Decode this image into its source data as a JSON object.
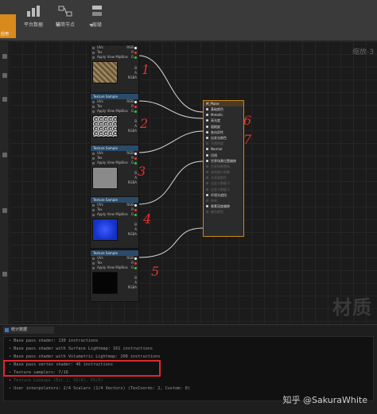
{
  "toolbar": {
    "buttons": [
      {
        "label": "应用"
      },
      {
        "label": "平台数据"
      },
      {
        "label": "精简节点"
      },
      {
        "label": "层级"
      }
    ]
  },
  "graph": {
    "zoom_label": "缩放-3",
    "watermark": "材质"
  },
  "texture_nodes": [
    {
      "header": "",
      "pins": [
        "UVs",
        "Tex",
        "Apply View MipBias"
      ],
      "outputs": [
        "RGB",
        "R",
        "G",
        "B",
        "A",
        "RGBA"
      ],
      "swatch": "metal-mesh-gold"
    },
    {
      "header": "Texture Sample",
      "pins": [
        "UVs",
        "Tex",
        "Apply View MipBias"
      ],
      "outputs": [
        "RGB",
        "R",
        "G",
        "B",
        "A",
        "RGBA"
      ],
      "swatch": "metal-mesh-silver"
    },
    {
      "header": "Texture Sample",
      "pins": [
        "UVs",
        "Tex",
        "Apply View MipBias"
      ],
      "outputs": [
        "RGB",
        "R",
        "G",
        "B",
        "A",
        "RGBA"
      ],
      "swatch": "flat-grey"
    },
    {
      "header": "Texture Sample",
      "pins": [
        "UVs",
        "Tex",
        "Apply View MipBias"
      ],
      "outputs": [
        "RGB",
        "R",
        "G",
        "B",
        "A",
        "RGBA"
      ],
      "swatch": "blue-normal"
    },
    {
      "header": "Texture Sample",
      "pins": [
        "UVs",
        "Tex",
        "Apply View MipBias"
      ],
      "outputs": [
        "RGB",
        "R",
        "G",
        "B",
        "A",
        "RGBA"
      ],
      "swatch": "black"
    }
  ],
  "material_node": {
    "header": "M_Plane",
    "pins": [
      {
        "label": "基础颜色",
        "active": true
      },
      {
        "label": "Metallic",
        "active": true
      },
      {
        "label": "高光度",
        "active": true
      },
      {
        "label": "粗糙度",
        "active": true
      },
      {
        "label": "各向异性",
        "active": true
      },
      {
        "label": "自发光颜色",
        "active": true
      },
      {
        "label": "不透明度",
        "active": false
      },
      {
        "label": "Normal",
        "active": true
      },
      {
        "label": "切线",
        "active": true
      },
      {
        "label": "世界场景位置偏移",
        "active": true
      },
      {
        "label": "世界场景置换",
        "active": false
      },
      {
        "label": "曲面细分乘数",
        "active": false
      },
      {
        "label": "次表面颜色",
        "active": false
      },
      {
        "label": "自定义数据 0",
        "active": false
      },
      {
        "label": "自定义数据 1",
        "active": false
      },
      {
        "label": "环境光遮挡",
        "active": true
      },
      {
        "label": "折射",
        "active": false
      },
      {
        "label": "像素深度偏移",
        "active": true
      },
      {
        "label": "着色模型",
        "active": false
      }
    ]
  },
  "annotations": [
    "1",
    "2",
    "3",
    "4",
    "5",
    "6",
    "7"
  ],
  "stats_panel": {
    "tab_label": "统计数据",
    "lines": [
      {
        "text": "Base pass shader: 130 instructions",
        "faint": false
      },
      {
        "text": "Base pass shader with Surface Lightmap: 161 instructions",
        "faint": false
      },
      {
        "text": "Base pass shader with Volumetric Lightmap: 208 instructions",
        "faint": false
      },
      {
        "text": "Base pass vertex shader: 46 instructions",
        "faint": false
      },
      {
        "text": "Texture samplers: 7/16",
        "faint": false
      },
      {
        "text": "Texture Lookups (Est.): VS(0), PS(5)",
        "faint": true
      },
      {
        "text": "User interpolators: 2/4 Scalars (1/4 Vectors) (TexCoords: 2, Custom: 0)",
        "faint": false
      }
    ]
  },
  "credit": "知乎 @SakuraWhite",
  "colors": {
    "highlight": "#e0262f",
    "material_border": "#c8871c",
    "annotation": "#e53030"
  }
}
